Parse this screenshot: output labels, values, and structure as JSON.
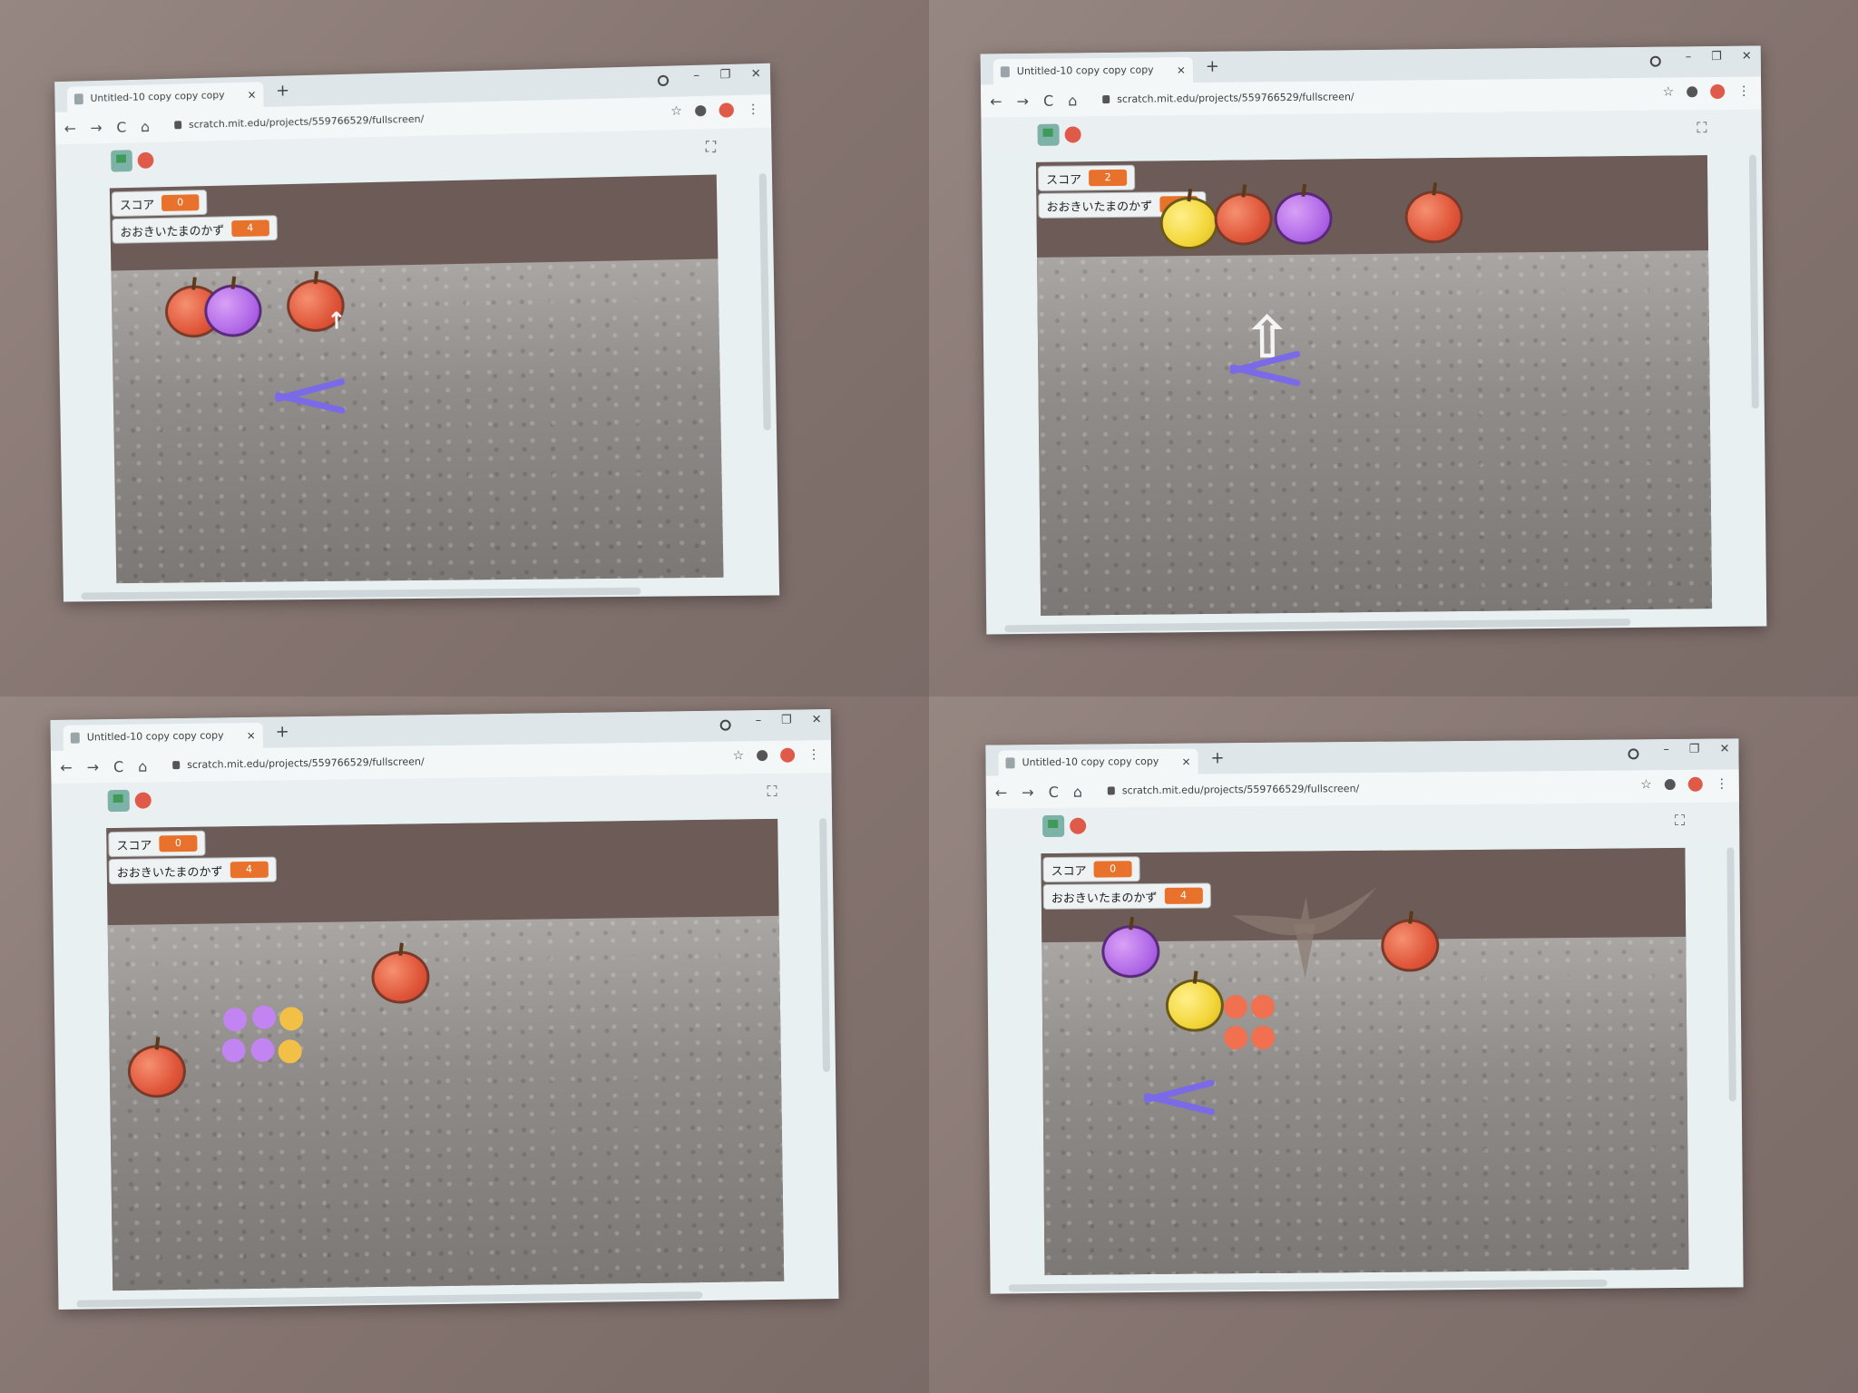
{
  "browser": {
    "tab_title": "Untitled-10 copy copy copy",
    "tab_close": "×",
    "new_tab": "+",
    "url": "scratch.mit.edu/projects/559766529/fullscreen/",
    "win_min": "–",
    "win_max": "❐",
    "win_close": "✕"
  },
  "nav": {
    "back": "←",
    "forward": "→",
    "reload": "C",
    "home": "⌂",
    "star": "☆",
    "menu": "⋮",
    "fullscreen": "⛶"
  },
  "labels": {
    "score": "スコア",
    "remaining": "おおきいたまのかず"
  },
  "frames": [
    {
      "score": "0",
      "remaining": "4"
    },
    {
      "score": "2",
      "remaining": "2"
    },
    {
      "score": "0",
      "remaining": "4"
    },
    {
      "score": "0",
      "remaining": "4"
    }
  ],
  "colors": {
    "accent": "#e8722c",
    "stop": "#e05a4a",
    "flag": "#3f9a57"
  }
}
